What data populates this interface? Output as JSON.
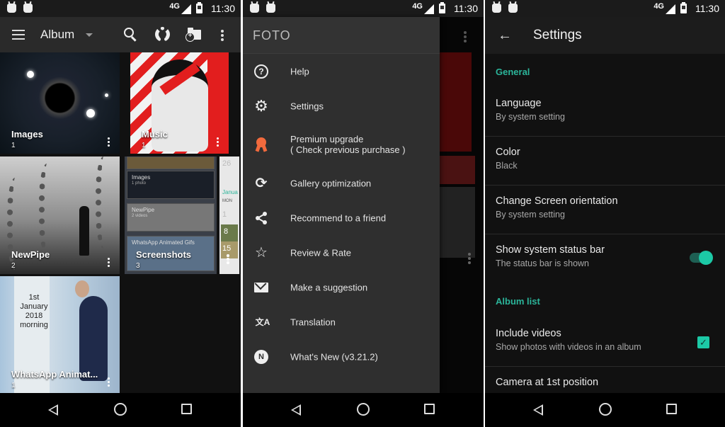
{
  "status_bar": {
    "network": "4G",
    "time": "11:30"
  },
  "panel1": {
    "appbar": {
      "title": "Album",
      "icons": [
        "menu-icon",
        "dropdown-icon",
        "search-icon",
        "lens-icon",
        "new-folder-icon",
        "more-icon"
      ]
    },
    "albums": [
      {
        "name": "Images",
        "count": "1"
      },
      {
        "name": "Music",
        "count": "1"
      },
      {
        "name": "NewPipe",
        "count": "2"
      },
      {
        "name": "Screenshots",
        "count": "3"
      },
      {
        "name": "WhatsApp Animat...",
        "count": "1"
      }
    ],
    "screenshot_strips": [
      {
        "name": "Images",
        "sub": "1 photo"
      },
      {
        "name": "NewPipe",
        "sub": "2 videos"
      },
      {
        "name": "WhatsApp Animated Gifs",
        "sub": ""
      }
    ],
    "calendar_strip": [
      "26",
      "Janua",
      "MON",
      "1",
      "8",
      "15"
    ],
    "whatsapp_note": [
      "1st",
      "January",
      "2018",
      "morning"
    ]
  },
  "panel2": {
    "drawer_title": "FOTO",
    "menu": [
      {
        "label": "Help",
        "icon": "help-icon",
        "glyph": "?"
      },
      {
        "label": "Settings",
        "icon": "gear-icon",
        "glyph": "⚙"
      },
      {
        "label": "Premium upgrade",
        "sub": "( Check previous purchase )",
        "icon": "premium-badge-icon",
        "color": "#f26a3d"
      },
      {
        "label": "Gallery optimization",
        "icon": "sync-icon",
        "glyph": "⟳"
      },
      {
        "label": "Recommend to a friend",
        "icon": "share-icon",
        "glyph": "≺"
      },
      {
        "label": "Review & Rate",
        "icon": "star-icon",
        "glyph": "☆"
      },
      {
        "label": "Make a suggestion",
        "icon": "mail-icon"
      },
      {
        "label": "Translation",
        "icon": "translate-icon",
        "glyph": "文A"
      },
      {
        "label": "What's New (v3.21.2)",
        "icon": "new-badge-icon",
        "glyph": "N"
      }
    ]
  },
  "panel3": {
    "title": "Settings",
    "sections": [
      {
        "header": "General"
      },
      {
        "header": "Album list"
      }
    ],
    "prefs": [
      {
        "title": "Language",
        "summary": "By system setting"
      },
      {
        "title": "Color",
        "summary": "Black"
      },
      {
        "title": "Change Screen orientation",
        "summary": "By system setting"
      },
      {
        "title": "Show system status bar",
        "summary": "The status bar is shown",
        "toggle": true
      },
      {
        "title": "Include videos",
        "summary": "Show photos with videos in an album",
        "checked": true
      },
      {
        "title": "Camera at 1st position",
        "summary": ""
      }
    ],
    "accent": "#1cc9a6",
    "section_color": "#2bb59a"
  }
}
